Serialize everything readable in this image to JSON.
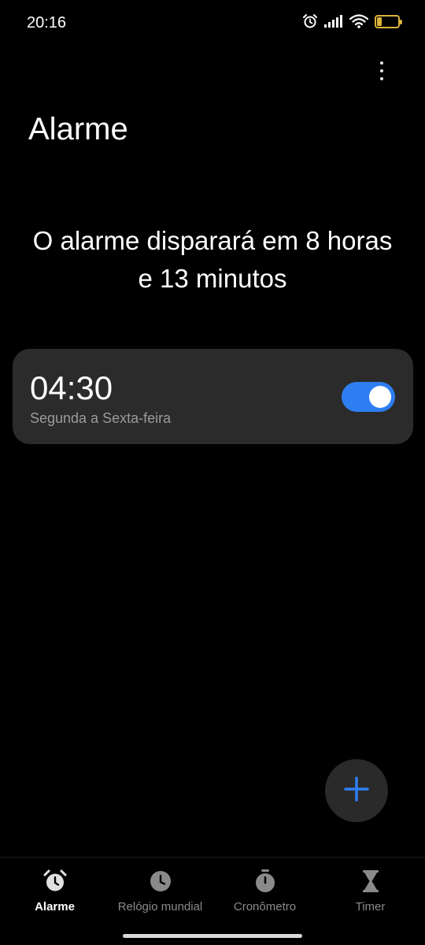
{
  "status_bar": {
    "time": "20:16",
    "battery_level": "22",
    "battery_fraction": 0.22,
    "icons": [
      "alarm-clock-icon",
      "signal-icon",
      "wifi-icon",
      "battery-icon"
    ]
  },
  "header": {
    "title": "Alarme",
    "menu_icon": "more-vertical-icon"
  },
  "next_alarm_message": "O alarme disparará em 8 horas e 13 minutos",
  "alarms": [
    {
      "time": "04:30",
      "repeat": "Segunda a Sexta-feira",
      "enabled": true
    }
  ],
  "fab": {
    "icon": "plus-icon"
  },
  "bottom_nav": {
    "items": [
      {
        "label": "Alarme",
        "icon": "alarm-clock-icon",
        "active": true
      },
      {
        "label": "Relógio mundial",
        "icon": "clock-icon",
        "active": false
      },
      {
        "label": "Cronômetro",
        "icon": "stopwatch-icon",
        "active": false
      },
      {
        "label": "Timer",
        "icon": "hourglass-icon",
        "active": false
      }
    ]
  },
  "colors": {
    "background": "#000000",
    "card": "#2b2b2b",
    "accent": "#2e7ef2",
    "battery": "#d9b23a",
    "secondary_text": "#9a9a9a"
  }
}
